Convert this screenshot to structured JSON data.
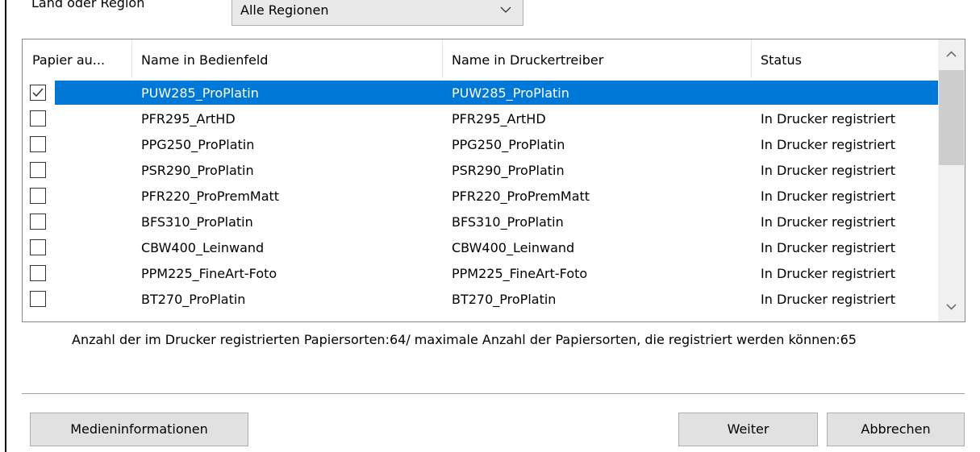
{
  "region": {
    "label": "Land oder Region",
    "selected": "Alle Regionen"
  },
  "table": {
    "columns": [
      "Papier au...",
      "Name in Bedienfeld",
      "Name in Druckertreiber",
      "Status"
    ],
    "rows": [
      {
        "checked": true,
        "panel": "PUW285_ProPlatin",
        "driver": "PUW285_ProPlatin",
        "status": ""
      },
      {
        "checked": false,
        "panel": "PFR295_ArtHD",
        "driver": "PFR295_ArtHD",
        "status": "In Drucker registriert"
      },
      {
        "checked": false,
        "panel": "PPG250_ProPlatin",
        "driver": "PPG250_ProPlatin",
        "status": "In Drucker registriert"
      },
      {
        "checked": false,
        "panel": "PSR290_ProPlatin",
        "driver": "PSR290_ProPlatin",
        "status": "In Drucker registriert"
      },
      {
        "checked": false,
        "panel": "PFR220_ProPremMatt",
        "driver": "PFR220_ProPremMatt",
        "status": "In Drucker registriert"
      },
      {
        "checked": false,
        "panel": "BFS310_ProPlatin",
        "driver": "BFS310_ProPlatin",
        "status": "In Drucker registriert"
      },
      {
        "checked": false,
        "panel": "CBW400_Leinwand",
        "driver": "CBW400_Leinwand",
        "status": "In Drucker registriert"
      },
      {
        "checked": false,
        "panel": "PPM225_FineArt-Foto",
        "driver": "PPM225_FineArt-Foto",
        "status": "In Drucker registriert"
      },
      {
        "checked": false,
        "panel": "BT270_ProPlatin",
        "driver": "BT270_ProPlatin",
        "status": "In Drucker registriert"
      }
    ],
    "selected_row": 0
  },
  "count_text": "Anzahl der im Drucker registrierten Papiersorten:64/ maximale Anzahl der Papiersorten, die registriert werden können:65",
  "buttons": {
    "media_info": "Medieninformationen",
    "next": "Weiter",
    "cancel": "Abbrechen"
  },
  "colors": {
    "selection": "#0078d7",
    "button_bg": "#e1e1e1"
  }
}
